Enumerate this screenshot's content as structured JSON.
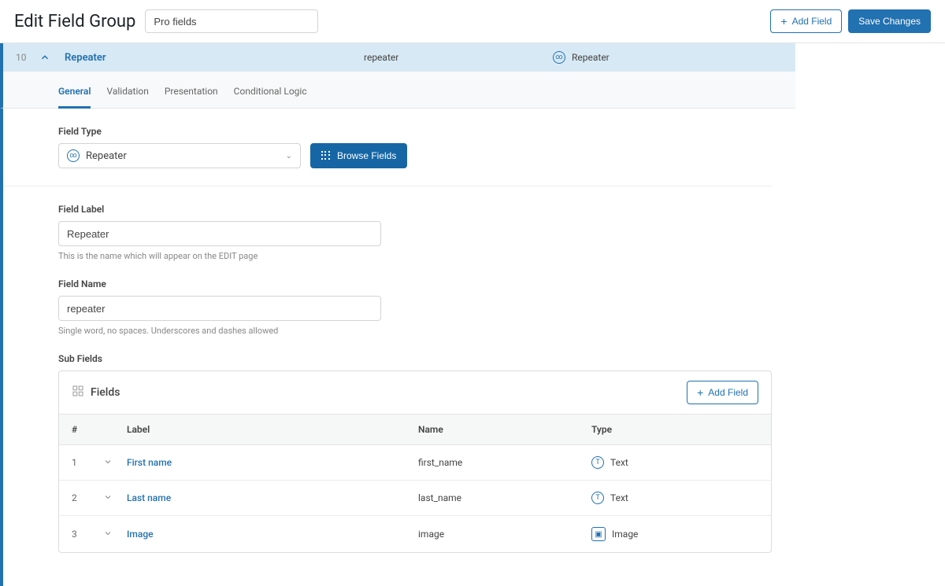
{
  "header": {
    "page_title": "Edit Field Group",
    "group_name": "Pro fields",
    "add_field": "Add Field",
    "save_changes": "Save Changes"
  },
  "field_row": {
    "order": "10",
    "label": "Repeater",
    "name": "repeater",
    "type_label": "Repeater"
  },
  "tabs": {
    "general": "General",
    "validation": "Validation",
    "presentation": "Presentation",
    "conditional": "Conditional Logic"
  },
  "field_type": {
    "label": "Field Type",
    "value": "Repeater",
    "browse": "Browse Fields"
  },
  "field_label": {
    "label": "Field Label",
    "value": "Repeater",
    "help": "This is the name which will appear on the EDIT page"
  },
  "field_name": {
    "label": "Field Name",
    "value": "repeater",
    "help": "Single word, no spaces. Underscores and dashes allowed"
  },
  "subfields": {
    "section_label": "Sub Fields",
    "box_title": "Fields",
    "add_field": "Add Field",
    "cols": {
      "num": "#",
      "label": "Label",
      "name": "Name",
      "type": "Type"
    },
    "rows": [
      {
        "num": "1",
        "label": "First name",
        "name": "first_name",
        "type": "Text",
        "icon": "T"
      },
      {
        "num": "2",
        "label": "Last name",
        "name": "last_name",
        "type": "Text",
        "icon": "T"
      },
      {
        "num": "3",
        "label": "Image",
        "name": "image",
        "type": "Image",
        "icon": "▣"
      }
    ]
  }
}
